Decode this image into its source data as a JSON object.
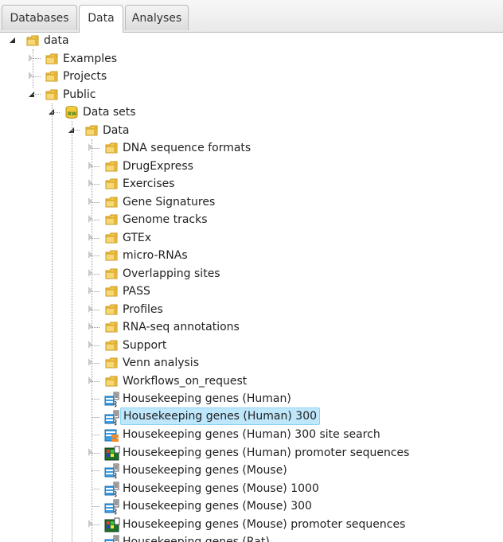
{
  "tabs": {
    "databases": "Databases",
    "data": "Data",
    "analyses": "Analyses"
  },
  "tree": {
    "root": "data",
    "examples": "Examples",
    "projects": "Projects",
    "public": "Public",
    "datasets": "Data sets",
    "data_folder": "Data",
    "folders": [
      "DNA sequence formats",
      "DrugExpress",
      "Exercises",
      "Gene Signatures",
      "Genome tracks",
      "GTEx",
      "micro-RNAs",
      "Overlapping sites",
      "PASS",
      "Profiles",
      "RNA-seq annotations",
      "Support",
      "Venn analysis",
      "Workflows_on_request"
    ],
    "items": [
      {
        "label": "Housekeeping genes (Human)",
        "icon": "gene-table-icon",
        "selected": false
      },
      {
        "label": "Housekeeping genes (Human) 300",
        "icon": "gene-table-icon",
        "selected": true
      },
      {
        "label": "Housekeeping genes (Human) 300 site search",
        "icon": "site-search-table-icon",
        "selected": false
      },
      {
        "label": "Housekeeping genes (Human) promoter sequences",
        "icon": "sequences-icon",
        "selected": false
      },
      {
        "label": "Housekeeping genes (Mouse)",
        "icon": "gene-table-icon",
        "selected": false
      },
      {
        "label": "Housekeeping genes (Mouse) 1000",
        "icon": "gene-table-icon",
        "selected": false
      },
      {
        "label": "Housekeeping genes (Mouse) 300",
        "icon": "gene-table-icon",
        "selected": false
      },
      {
        "label": "Housekeeping genes (Mouse) promoter sequences",
        "icon": "sequences-icon",
        "selected": false
      },
      {
        "label": "Housekeeping genes (Rat)",
        "icon": "gene-table-icon",
        "selected": false
      }
    ]
  },
  "colors": {
    "selection_bg": "#bfe7fb",
    "folder": "#f0c24a",
    "accent": "#2a8fd8"
  }
}
